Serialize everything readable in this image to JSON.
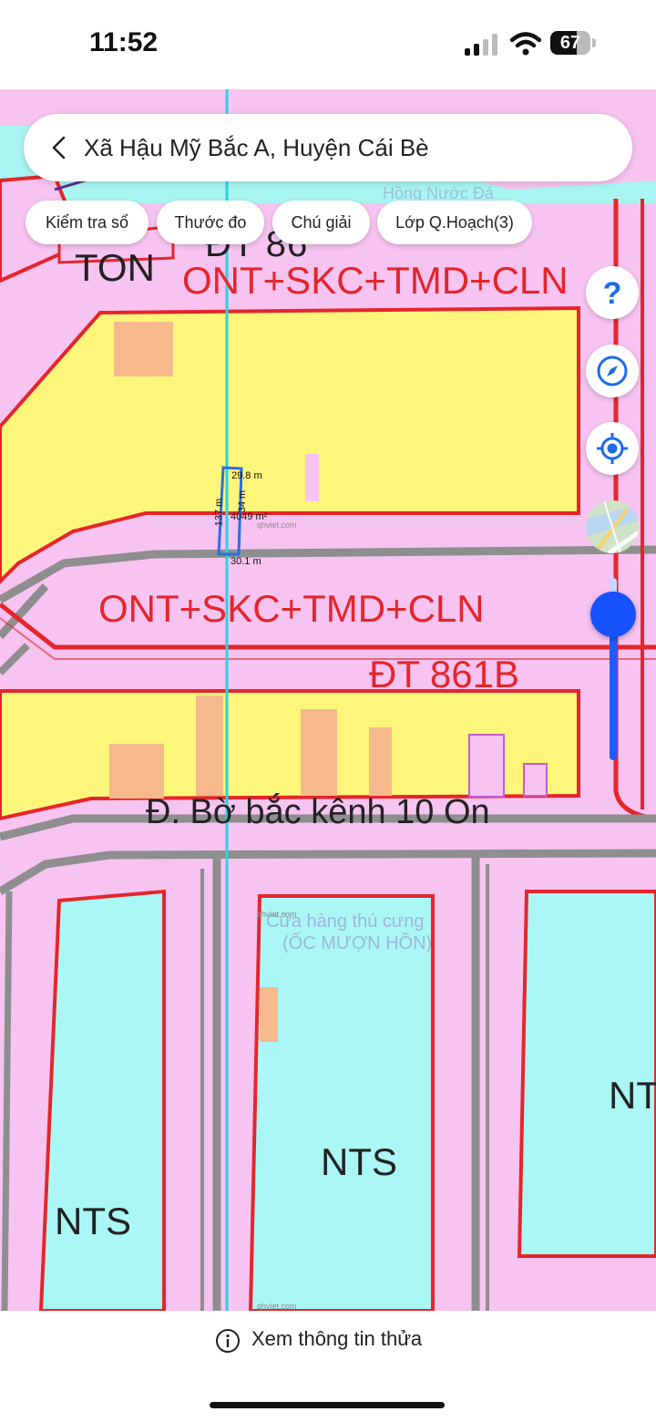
{
  "status_bar": {
    "time": "11:52",
    "battery": "67",
    "battery_level": 0.67
  },
  "header": {
    "back_icon": "chevron-left-icon",
    "title": "Xã Hậu Mỹ Bắc A, Huyện Cái Bè"
  },
  "chips": [
    {
      "label": "Kiểm tra sổ"
    },
    {
      "label": "Thước đo"
    },
    {
      "label": "Chú giải"
    },
    {
      "label": "Lớp Q.Hoạch(3)"
    }
  ],
  "map_controls": {
    "help_icon": "question-icon",
    "compass_icon": "compass-icon",
    "locate_icon": "locate-icon",
    "basemap_icon": "basemap-thumbnail",
    "zoom_level": 0.2
  },
  "map": {
    "labels": {
      "top_partial": "ĐT 86",
      "ton": "TON",
      "zone_top": "ONT+SKC+TMD+CLN",
      "zone_mid": "ONT+SKC+TMD+CLN",
      "road_dt": "ĐT 861B",
      "road_canal": "Đ. Bờ bắc kênh 10 On",
      "nts_left": "NTS",
      "nts_center": "NTS",
      "nts_right": "NT",
      "poi_top": "Hồng Nước Đá",
      "poi_pet_1": "Cửa hàng thú cưng",
      "poi_pet_2": "(ỐC MƯỢN HỒN)",
      "watermark": "qhviet.com"
    },
    "parcel": {
      "top_edge": "29.8 m",
      "left_edge": "137 m",
      "right_edge": "34 m",
      "area": "4049 m²",
      "bottom_edge": "30.1 m"
    },
    "colors": {
      "residential": "#f7c3f1",
      "yellow_zone": "#fdf67a",
      "aquaculture": "#aaf7f5",
      "boundary": "#e4262c",
      "road": "#8e8e8e",
      "parcel": "#2b6fe0"
    }
  },
  "bottom": {
    "info_icon": "info-circle-icon",
    "label": "Xem thông tin thửa"
  }
}
